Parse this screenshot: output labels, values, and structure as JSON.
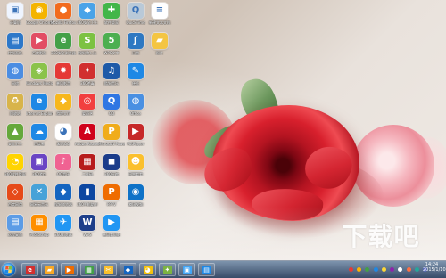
{
  "colors": {
    "taskbar": "#2f4362",
    "rose": "#d8202d",
    "pink_rose": "#f6b6bf"
  },
  "desktop": {
    "icons": [
      {
        "label": "计算机",
        "icon": "computer-icon",
        "color": "#eef4ff",
        "glyph": "▣"
      },
      {
        "label": "Google Chrome",
        "icon": "chrome-icon",
        "color": "#f4b400",
        "glyph": "◉"
      },
      {
        "label": "Mozilla Firefox",
        "icon": "firefox-icon",
        "color": "#f26b1d",
        "glyph": "●"
      },
      {
        "label": "360安全卫士",
        "icon": "shield-icon",
        "color": "#4aa3e8",
        "glyph": "◆"
      },
      {
        "label": "软件管家",
        "icon": "app-icon",
        "color": "#42b649",
        "glyph": "✚"
      },
      {
        "label": "QuickTime",
        "icon": "quicktime-icon",
        "color": "#b9c9d8",
        "glyph": "Q"
      },
      {
        "label": "新建文本文档",
        "icon": "document-icon",
        "color": "#ffffff",
        "glyph": "≡"
      },
      {
        "label": "控制面板",
        "icon": "control-panel-icon",
        "color": "#2d78c9",
        "glyph": "▤"
      },
      {
        "label": "百度影音",
        "icon": "media-player-icon",
        "color": "#e24d64",
        "glyph": "▶"
      },
      {
        "label": "360安全浏览器",
        "icon": "browser-icon",
        "color": "#43a047",
        "glyph": "e"
      },
      {
        "label": "搜狗输入法",
        "icon": "input-method-icon",
        "color": "#7cc242",
        "glyph": "S"
      },
      {
        "label": "WPS文字",
        "icon": "wps-icon",
        "color": "#4caf50",
        "glyph": "5"
      },
      {
        "label": "迅雷",
        "icon": "thunder-icon",
        "color": "#2e78c2",
        "glyph": "ʃ"
      },
      {
        "label": "照片",
        "icon": "folder-icon",
        "color": "#f4c542",
        "glyph": "▰"
      },
      {
        "label": "网络",
        "icon": "network-icon",
        "color": "#4b8de2",
        "glyph": "◍"
      },
      {
        "label": "Windows Media Center",
        "icon": "media-center-icon",
        "color": "#8bc34a",
        "glyph": "◈"
      },
      {
        "label": "暴风影音",
        "icon": "storm-player-icon",
        "color": "#e53935",
        "glyph": "✹"
      },
      {
        "label": "360杀毒",
        "icon": "antivirus-icon",
        "color": "#d12f2f",
        "glyph": "✦"
      },
      {
        "label": "酷狗音乐",
        "icon": "music-icon",
        "color": "#1e5aa8",
        "glyph": "♫"
      },
      {
        "label": "便签",
        "icon": "notes-icon",
        "color": "#1e88e5",
        "glyph": "✎"
      },
      {
        "label": "回收站",
        "icon": "recycle-bin-icon",
        "color": "#d8b44a",
        "glyph": "♻"
      },
      {
        "label": "Internet Explorer",
        "icon": "internet-explorer-icon",
        "color": "#1e88e5",
        "glyph": "e"
      },
      {
        "label": "游戏大厅",
        "icon": "game-icon",
        "color": "#f7b71d",
        "glyph": "◆"
      },
      {
        "label": "爱奇艺",
        "icon": "iqiyi-icon",
        "color": "#f23f3f",
        "glyph": "◎"
      },
      {
        "label": "QQ",
        "icon": "qq-icon",
        "color": "#2f76e3",
        "glyph": "Q"
      },
      {
        "label": "Office",
        "icon": "office-icon",
        "color": "#4a90e2",
        "glyph": "◍"
      },
      {
        "label": "安全卫士",
        "icon": "security-icon",
        "color": "#65a83b",
        "glyph": "▲"
      },
      {
        "label": "百度云",
        "icon": "cloud-icon",
        "color": "#1e88e5",
        "glyph": "☁"
      },
      {
        "label": "腾讯QQ",
        "icon": "penguin-icon",
        "color": "#ffffff",
        "glyph": "◕"
      },
      {
        "label": "Adobe Reader",
        "icon": "pdf-icon",
        "color": "#d0021b",
        "glyph": "A"
      },
      {
        "label": "Microsoft PowerPoint",
        "icon": "powerpoint-icon",
        "color": "#f0ac1b",
        "glyph": "P"
      },
      {
        "label": "PotPlayer",
        "icon": "player-icon",
        "color": "#c62828",
        "glyph": "▶"
      },
      {
        "label": "360软件管家",
        "icon": "software-manager-icon",
        "color": "#ffd400",
        "glyph": "◔"
      },
      {
        "label": "360游戏",
        "icon": "game-box-icon",
        "color": "#6a45c4",
        "glyph": "▣"
      },
      {
        "label": "QQ音乐",
        "icon": "qq-music-icon",
        "color": "#f06292",
        "glyph": "♪"
      },
      {
        "label": "二维码",
        "icon": "qr-code-icon",
        "color": "#b71c1c",
        "glyph": "▦"
      },
      {
        "label": "360压缩",
        "icon": "archive-icon",
        "color": "#1b3c8a",
        "glyph": "◼"
      },
      {
        "label": "迅雷看看",
        "icon": "video-icon",
        "color": "#fbc02d",
        "glyph": "☻"
      },
      {
        "label": "百度网盘",
        "icon": "baidu-icon",
        "color": "#e64a19",
        "glyph": "◇"
      },
      {
        "label": "网易云音乐",
        "icon": "netease-music-icon",
        "color": "#47a2d8",
        "glyph": "✕"
      },
      {
        "label": "搜狗浏览器",
        "icon": "sogou-browser-icon",
        "color": "#1565c0",
        "glyph": "◆"
      },
      {
        "label": "360手机助手",
        "icon": "phone-assistant-icon",
        "color": "#0d47a1",
        "glyph": "▮"
      },
      {
        "label": "PPTV",
        "icon": "pptv-icon",
        "color": "#ef6c00",
        "glyph": "P"
      },
      {
        "label": "腾讯视频",
        "icon": "tencent-video-icon",
        "color": "#0e72c7",
        "glyph": "◉"
      },
      {
        "label": "远程桌面",
        "icon": "remote-desktop-icon",
        "color": "#5c9ce6",
        "glyph": "▤"
      },
      {
        "label": "Photoshop",
        "icon": "photoshop-icon",
        "color": "#ff8f00",
        "glyph": "▦"
      },
      {
        "label": "360浏览器",
        "icon": "browser-360-icon",
        "color": "#2196f3",
        "glyph": "✈"
      },
      {
        "label": "WPS",
        "icon": "w-icon",
        "color": "#1e3f8a",
        "glyph": "W"
      },
      {
        "label": "暴风看电影",
        "icon": "movie-icon",
        "color": "#2196f3",
        "glyph": "▶"
      }
    ]
  },
  "watermark": {
    "text": "下载吧"
  },
  "taskbar": {
    "items": [
      {
        "label": "IE",
        "icon": "taskbar-browser-icon",
        "color": "#d32f2f",
        "glyph": "e"
      },
      {
        "label": "Explorer",
        "icon": "taskbar-folder-icon",
        "color": "#f9a825",
        "glyph": "▰"
      },
      {
        "label": "Media",
        "icon": "taskbar-media-icon",
        "color": "#ef6c00",
        "glyph": "▶"
      },
      {
        "label": "Sheet",
        "icon": "taskbar-sheet-icon",
        "color": "#43a047",
        "glyph": "▦"
      },
      {
        "label": "Snip",
        "icon": "taskbar-snip-icon",
        "color": "#fbc02d",
        "glyph": "✂"
      },
      {
        "label": "Game",
        "icon": "taskbar-game-icon",
        "color": "#1565c0",
        "glyph": "◆"
      },
      {
        "label": "QQ",
        "icon": "taskbar-qq-icon",
        "color": "#f4c20d",
        "glyph": "◕"
      },
      {
        "label": "Tool",
        "icon": "taskbar-tool-icon",
        "color": "#7cb342",
        "glyph": "✦"
      },
      {
        "label": "Window",
        "icon": "taskbar-window-icon",
        "color": "#42a5f5",
        "glyph": "▣"
      },
      {
        "label": "Photo",
        "icon": "taskbar-photo-icon",
        "color": "#1e88e5",
        "glyph": "▤"
      }
    ],
    "tray": [
      "#e53935",
      "#ffb300",
      "#43a047",
      "#1e88e5",
      "#fdd835",
      "#8e24aa",
      "#ffffff",
      "#ff7043",
      "#26a69a",
      "#5c6bc0"
    ],
    "time": "14:24",
    "date": "2015/1/10"
  }
}
